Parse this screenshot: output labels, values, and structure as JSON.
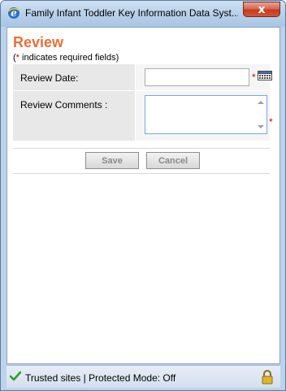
{
  "window": {
    "title": "Family Infant Toddler Key Information Data Syst...",
    "close_label": "x",
    "app_icon": "ie-icon"
  },
  "page": {
    "title": "Review",
    "required_note_star": "*",
    "required_note_text": " indicates required fields)",
    "required_note_open": "("
  },
  "form": {
    "review_date_label": "Review Date:",
    "review_date_value": "",
    "review_comments_label": "Review Comments :",
    "review_comments_value": "",
    "required_marker": "*",
    "calendar_icon": "calendar-icon"
  },
  "buttons": {
    "save_label": "Save",
    "cancel_label": "Cancel"
  },
  "statusbar": {
    "text": "Trusted sites | Protected Mode: Off",
    "check_icon": "check-icon",
    "lock_icon": "lock-icon"
  },
  "colors": {
    "title_accent": "#e8703a",
    "required_star": "#d00000"
  }
}
